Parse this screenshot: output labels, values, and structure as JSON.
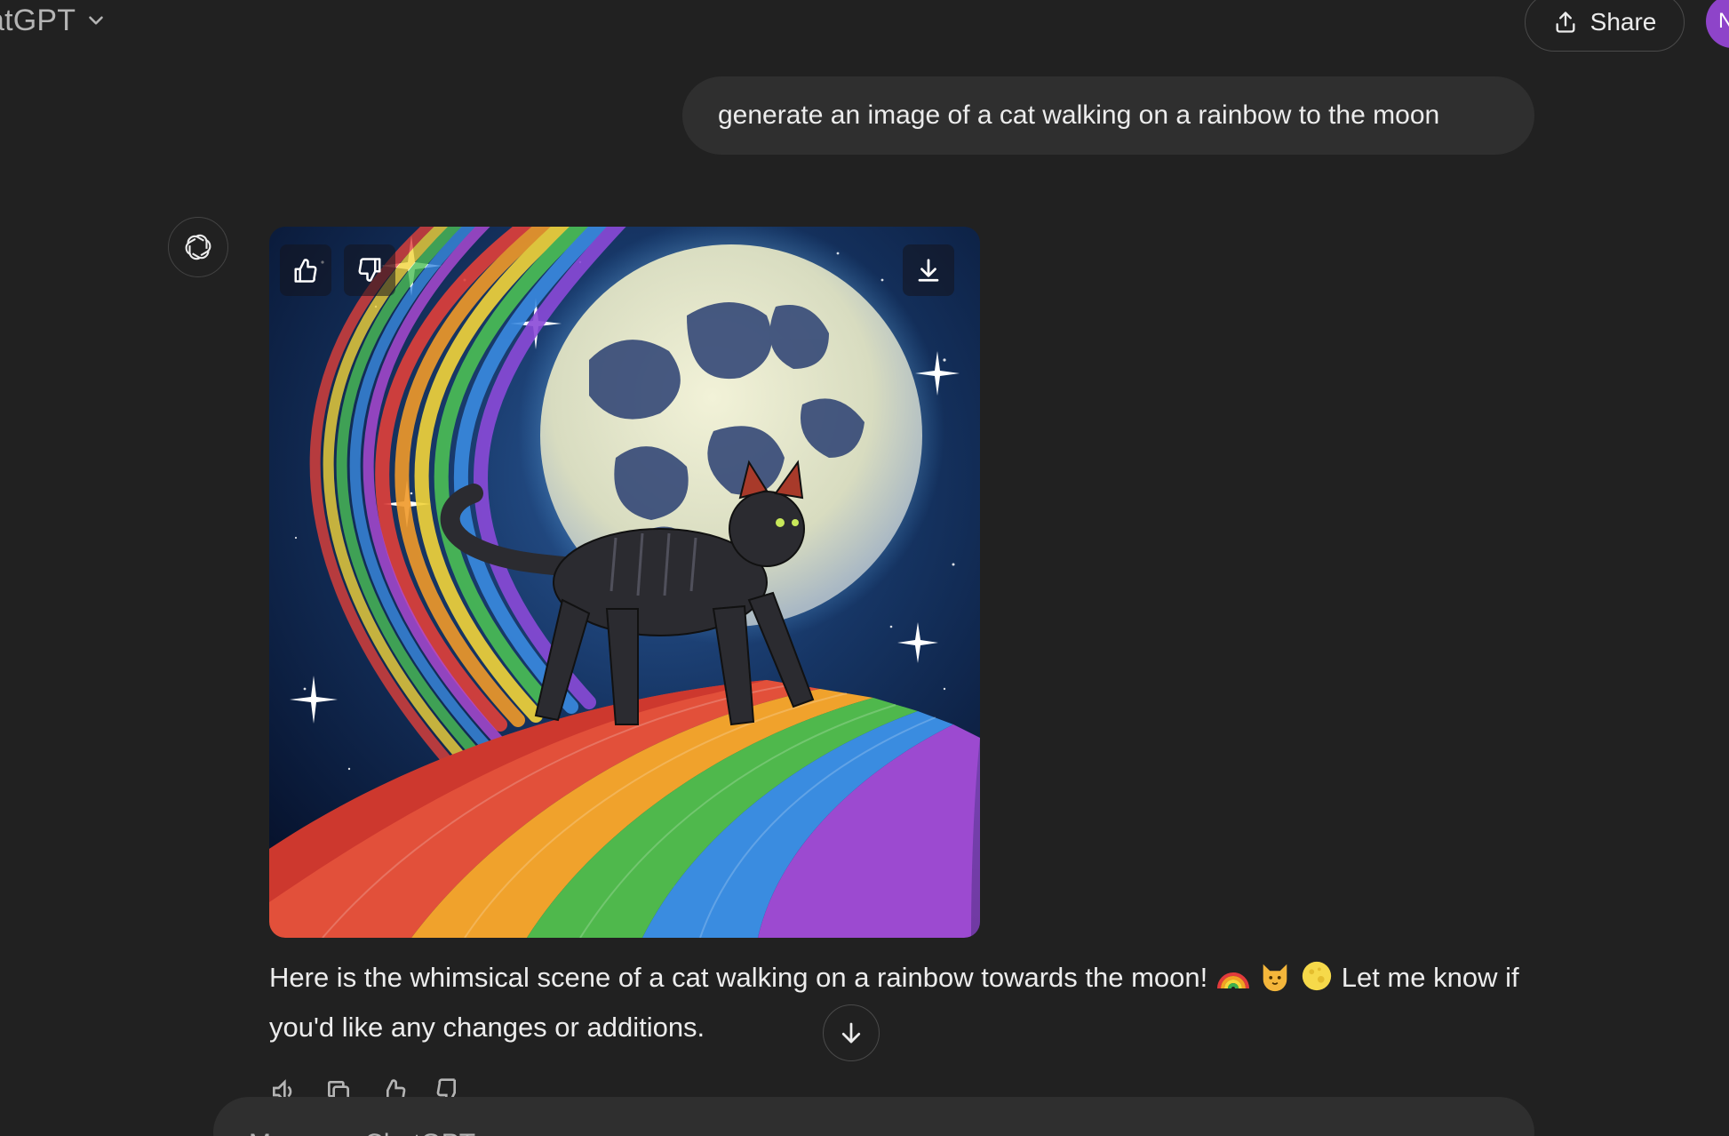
{
  "header": {
    "title": "atGPT",
    "share_label": "Share",
    "avatar_initial": "N"
  },
  "conversation": {
    "user_message": "generate an image of a cat walking on a rainbow to the moon",
    "assistant_reply_part1": "Here is the whimsical scene of a cat walking on a rainbow towards the moon! ",
    "assistant_reply_part2": " Let me know if you'd like any changes or additions.",
    "reply_emojis": [
      "rainbow",
      "cat-face",
      "full-moon"
    ],
    "image_subject": "black striped cat walking on a rainbow path toward a full moon in a starry sky"
  },
  "image_controls": {
    "like_icon": "thumbs-up-icon",
    "dislike_icon": "thumbs-down-icon",
    "download_icon": "download-icon"
  },
  "actions": [
    "read-aloud-icon",
    "copy-icon",
    "thumbs-up-icon",
    "thumbs-down-icon"
  ],
  "composer": {
    "placeholder": "Message ChatGPT"
  },
  "colors": {
    "background": "#212121",
    "bubble": "#2f2f2f",
    "text": "#ececec",
    "muted": "#b4b4b4",
    "avatar": "#8e44c9"
  }
}
